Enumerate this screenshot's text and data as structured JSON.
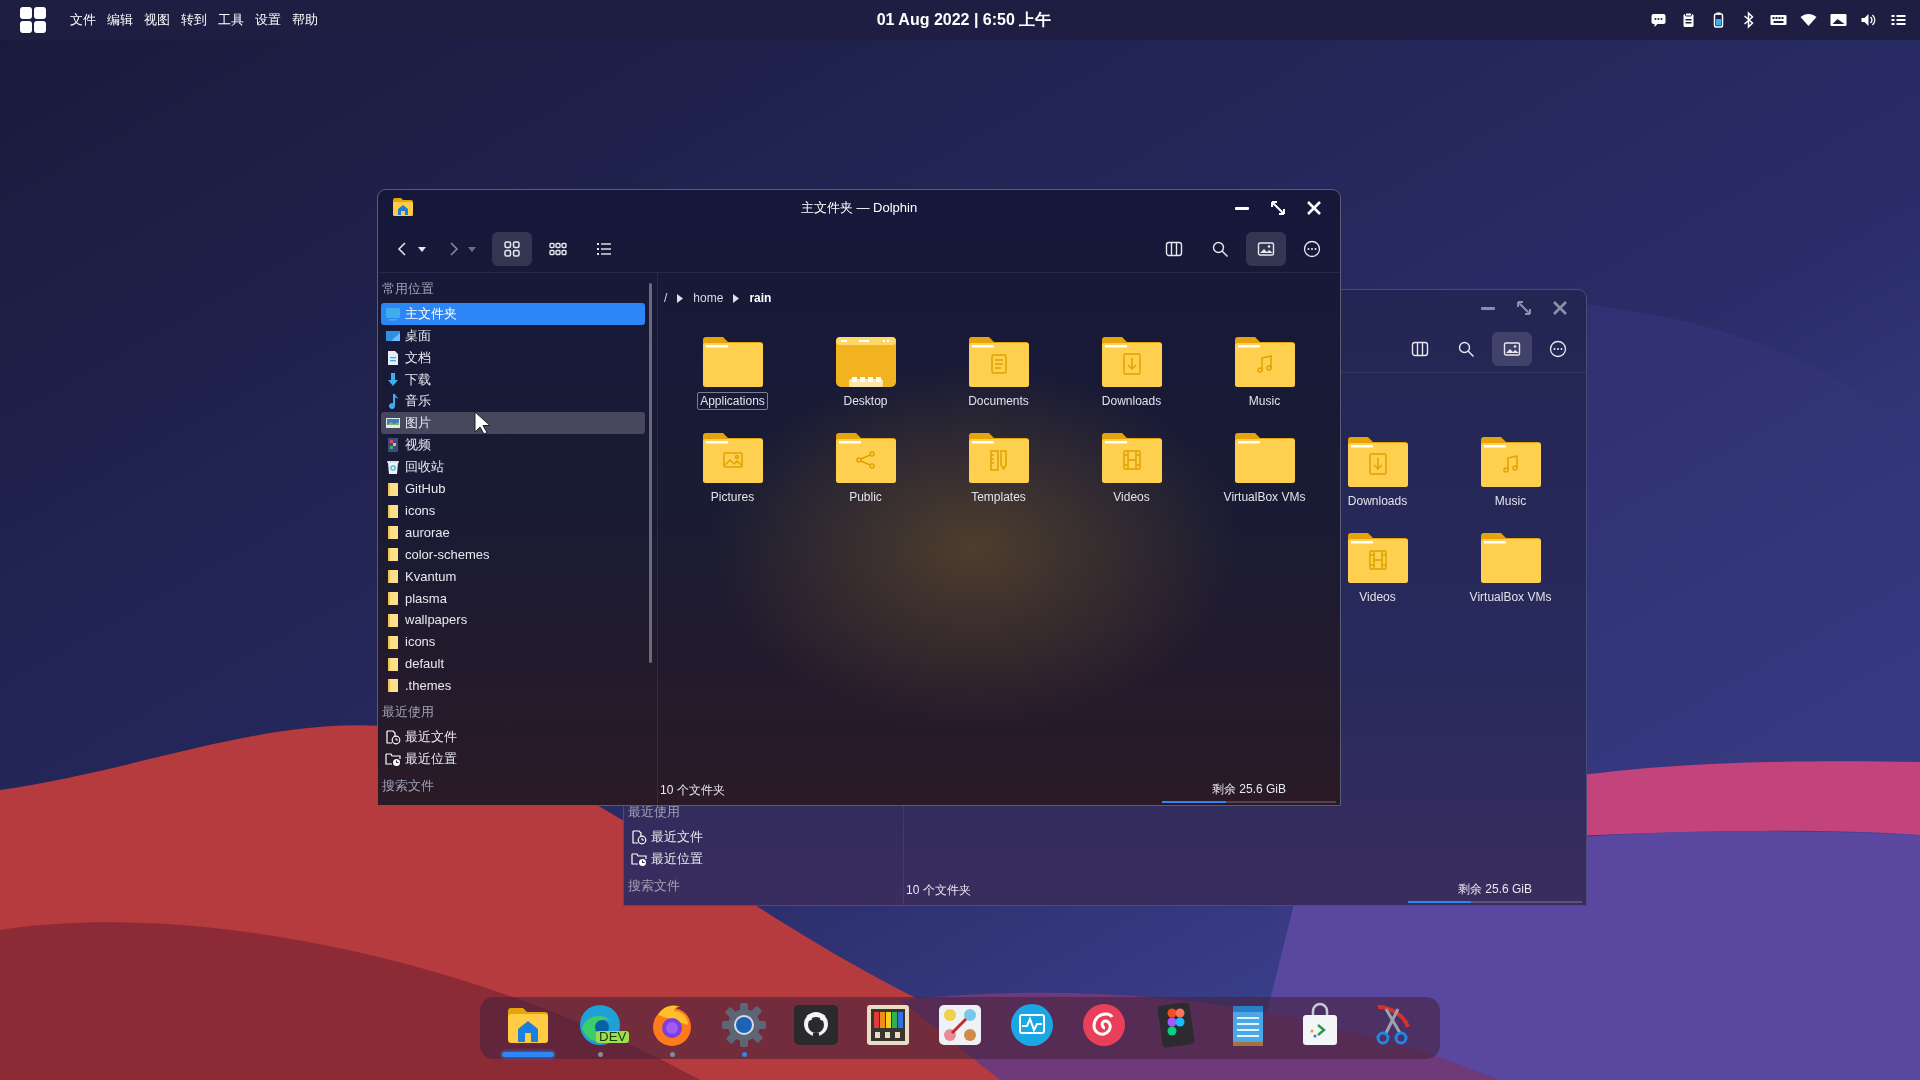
{
  "top_bar": {
    "menu": [
      "文件",
      "编辑",
      "视图",
      "转到",
      "工具",
      "设置",
      "帮助"
    ],
    "clock": "01 Aug 2022 | 6:50 上午"
  },
  "windows": [
    {
      "title": "主文件夹 — Dolphin",
      "active": true,
      "navigation": [
        {
          "kind": "back",
          "disabled": false
        },
        {
          "kind": "forward",
          "disabled": true
        }
      ],
      "view_modes": [
        {
          "kind": "icons",
          "selected": true
        },
        {
          "kind": "compact",
          "selected": false
        },
        {
          "kind": "details",
          "selected": false
        }
      ],
      "actions": [
        {
          "kind": "split",
          "on": false
        },
        {
          "kind": "search",
          "on": false
        },
        {
          "kind": "preview",
          "on": true
        },
        {
          "kind": "more",
          "on": false
        }
      ],
      "sidebar": [
        {
          "heading": "常用位置",
          "items": [
            {
              "label": "主文件夹",
              "kind": "home",
              "selected": true,
              "hovered": false
            },
            {
              "label": "桌面",
              "kind": "desktop",
              "selected": false,
              "hovered": false
            },
            {
              "label": "文档",
              "kind": "documents",
              "selected": false,
              "hovered": false
            },
            {
              "label": "下载",
              "kind": "downloads",
              "selected": false,
              "hovered": false
            },
            {
              "label": "音乐",
              "kind": "music",
              "selected": false,
              "hovered": false
            },
            {
              "label": "图片",
              "kind": "pictures",
              "selected": false,
              "hovered": true
            },
            {
              "label": "视频",
              "kind": "videos",
              "selected": false,
              "hovered": false
            },
            {
              "label": "回收站",
              "kind": "trash",
              "selected": false,
              "hovered": false
            },
            {
              "label": "GitHub",
              "kind": "folder",
              "selected": false,
              "hovered": false
            },
            {
              "label": "icons",
              "kind": "folder",
              "selected": false,
              "hovered": false
            },
            {
              "label": "aurorae",
              "kind": "folder",
              "selected": false,
              "hovered": false
            },
            {
              "label": "color-schemes",
              "kind": "folder",
              "selected": false,
              "hovered": false
            },
            {
              "label": "Kvantum",
              "kind": "folder",
              "selected": false,
              "hovered": false
            },
            {
              "label": "plasma",
              "kind": "folder",
              "selected": false,
              "hovered": false
            },
            {
              "label": "wallpapers",
              "kind": "folder",
              "selected": false,
              "hovered": false
            },
            {
              "label": "icons",
              "kind": "folder",
              "selected": false,
              "hovered": false
            },
            {
              "label": "default",
              "kind": "folder",
              "selected": false,
              "hovered": false
            },
            {
              "label": ".themes",
              "kind": "folder",
              "selected": false,
              "hovered": false
            }
          ]
        },
        {
          "heading": "最近使用",
          "items": [
            {
              "label": "最近文件",
              "kind": "recent-files",
              "selected": false,
              "hovered": false
            },
            {
              "label": "最近位置",
              "kind": "recent-places",
              "selected": false,
              "hovered": false
            }
          ]
        },
        {
          "heading": "搜索文件"
        }
      ],
      "breadcrumb": [
        {
          "label": "/",
          "current": false
        },
        {
          "label": "home",
          "current": false
        },
        {
          "label": "rain",
          "current": true
        }
      ],
      "folders": [
        {
          "name": "Applications",
          "kind": "plain",
          "focused": true
        },
        {
          "name": "Desktop",
          "kind": "desktop",
          "focused": false
        },
        {
          "name": "Documents",
          "kind": "documents",
          "focused": false
        },
        {
          "name": "Downloads",
          "kind": "downloads",
          "focused": false
        },
        {
          "name": "Music",
          "kind": "music",
          "focused": false
        },
        {
          "name": "Pictures",
          "kind": "pictures",
          "focused": false
        },
        {
          "name": "Public",
          "kind": "public",
          "focused": false
        },
        {
          "name": "Templates",
          "kind": "templates",
          "focused": false
        },
        {
          "name": "Videos",
          "kind": "videos",
          "focused": false
        },
        {
          "name": "VirtualBox VMs",
          "kind": "plain",
          "focused": false
        }
      ],
      "status": {
        "summary": "10 个文件夹",
        "free_space": "剩余 25.6 GiB",
        "level": 0.37
      }
    },
    {
      "active": false,
      "actions": [
        {
          "kind": "split",
          "on": false
        },
        {
          "kind": "search",
          "on": false
        },
        {
          "kind": "preview",
          "on": true
        },
        {
          "kind": "more",
          "on": false
        }
      ],
      "sidebar": [
        {
          "heading": "最近使用",
          "items": [
            {
              "label": "最近文件",
              "kind": "recent-files",
              "selected": false,
              "hovered": false
            },
            {
              "label": "最近位置",
              "kind": "recent-places",
              "selected": false,
              "hovered": false
            }
          ]
        },
        {
          "heading": "搜索文件"
        }
      ],
      "folders": [
        {
          "name": "Downloads",
          "kind": "downloads",
          "focused": false
        },
        {
          "name": "Music",
          "kind": "music",
          "focused": false
        },
        {
          "name": "Videos",
          "kind": "videos",
          "focused": false
        },
        {
          "name": "VirtualBox VMs",
          "kind": "plain",
          "focused": false
        }
      ],
      "status": {
        "summary": "10 个文件夹",
        "free_space": "剩余 25.6 GiB",
        "level": 0.36
      }
    }
  ],
  "dock": [
    {
      "kind": "files",
      "focused": true,
      "running": false,
      "attention": false
    },
    {
      "kind": "browser",
      "badge": "DEV",
      "focused": false,
      "running": true,
      "attention": false
    },
    {
      "kind": "flame-browser",
      "focused": false,
      "running": true,
      "attention": false
    },
    {
      "kind": "settings",
      "focused": false,
      "running": false,
      "attention": true
    },
    {
      "kind": "code-host",
      "focused": false,
      "running": false,
      "attention": false
    },
    {
      "kind": "color-bars",
      "focused": false,
      "running": false,
      "attention": false
    },
    {
      "kind": "color-picker",
      "focused": false,
      "running": false,
      "attention": false
    },
    {
      "kind": "monitor",
      "focused": false,
      "running": false,
      "attention": false
    },
    {
      "kind": "music-player",
      "focused": false,
      "running": false,
      "attention": false
    },
    {
      "kind": "design",
      "focused": false,
      "running": false,
      "attention": false
    },
    {
      "kind": "notes",
      "focused": false,
      "running": false,
      "attention": false
    },
    {
      "kind": "store",
      "focused": false,
      "running": false,
      "attention": false
    },
    {
      "kind": "screenshot",
      "focused": false,
      "running": false,
      "attention": false
    }
  ]
}
